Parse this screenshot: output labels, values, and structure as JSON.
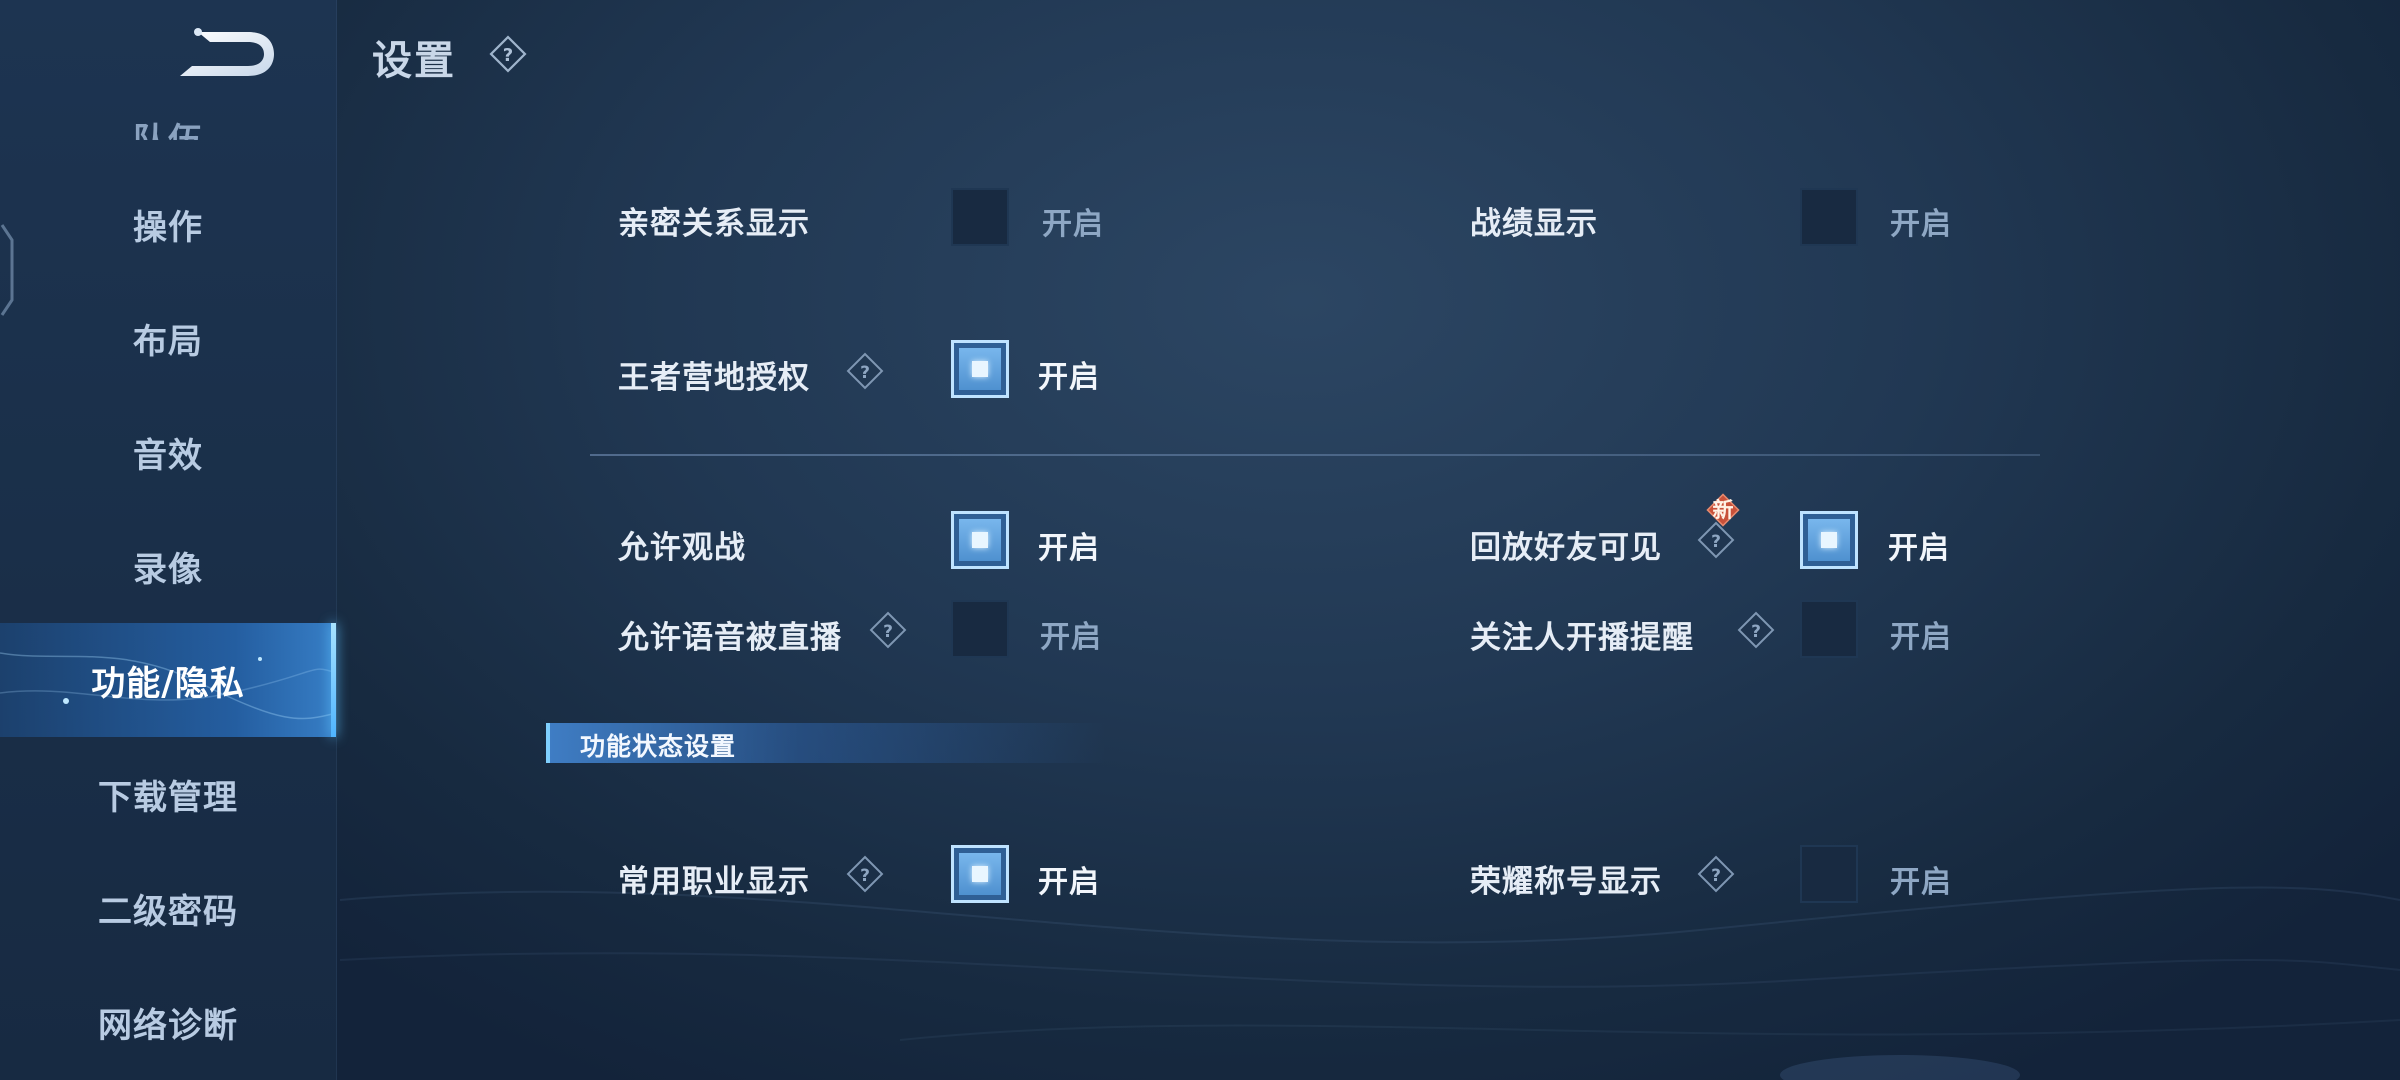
{
  "header": {
    "title": "设置"
  },
  "sidebar": {
    "items": [
      {
        "label": "操作"
      },
      {
        "label": "布局"
      },
      {
        "label": "音效"
      },
      {
        "label": "录像"
      },
      {
        "label": "功能/隐私"
      },
      {
        "label": "下载管理"
      },
      {
        "label": "二级密码"
      },
      {
        "label": "网络诊断"
      }
    ],
    "active_index": 4
  },
  "settings": {
    "intimacy_display": {
      "label": "亲密关系显示",
      "state": "开启",
      "checked": false
    },
    "record_display": {
      "label": "战绩显示",
      "state": "开启",
      "checked": false
    },
    "camp_auth": {
      "label": "王者营地授权",
      "state": "开启",
      "checked": true
    },
    "allow_spectate": {
      "label": "允许观战",
      "state": "开启",
      "checked": true
    },
    "replay_friends_visible": {
      "label": "回放好友可见",
      "state": "开启",
      "checked": true,
      "badge": "新"
    },
    "allow_voice_live": {
      "label": "允许语音被直播",
      "state": "开启",
      "checked": false
    },
    "follow_live_remind": {
      "label": "关注人开播提醒",
      "state": "开启",
      "checked": false
    },
    "common_role_display": {
      "label": "常用职业显示",
      "state": "开启",
      "checked": true
    },
    "honor_title_display": {
      "label": "荣耀称号显示",
      "state": "开启",
      "checked": false
    }
  },
  "section": {
    "title": "功能状态设置"
  },
  "colors": {
    "background": "#213853",
    "sidebar": "#1a2f49",
    "active_nav": "#2d6eb4",
    "checkbox_on": "#5fa2dc",
    "text_primary": "#e6edf6",
    "text_muted": "#8ea7c4",
    "badge": "#c8513a"
  }
}
